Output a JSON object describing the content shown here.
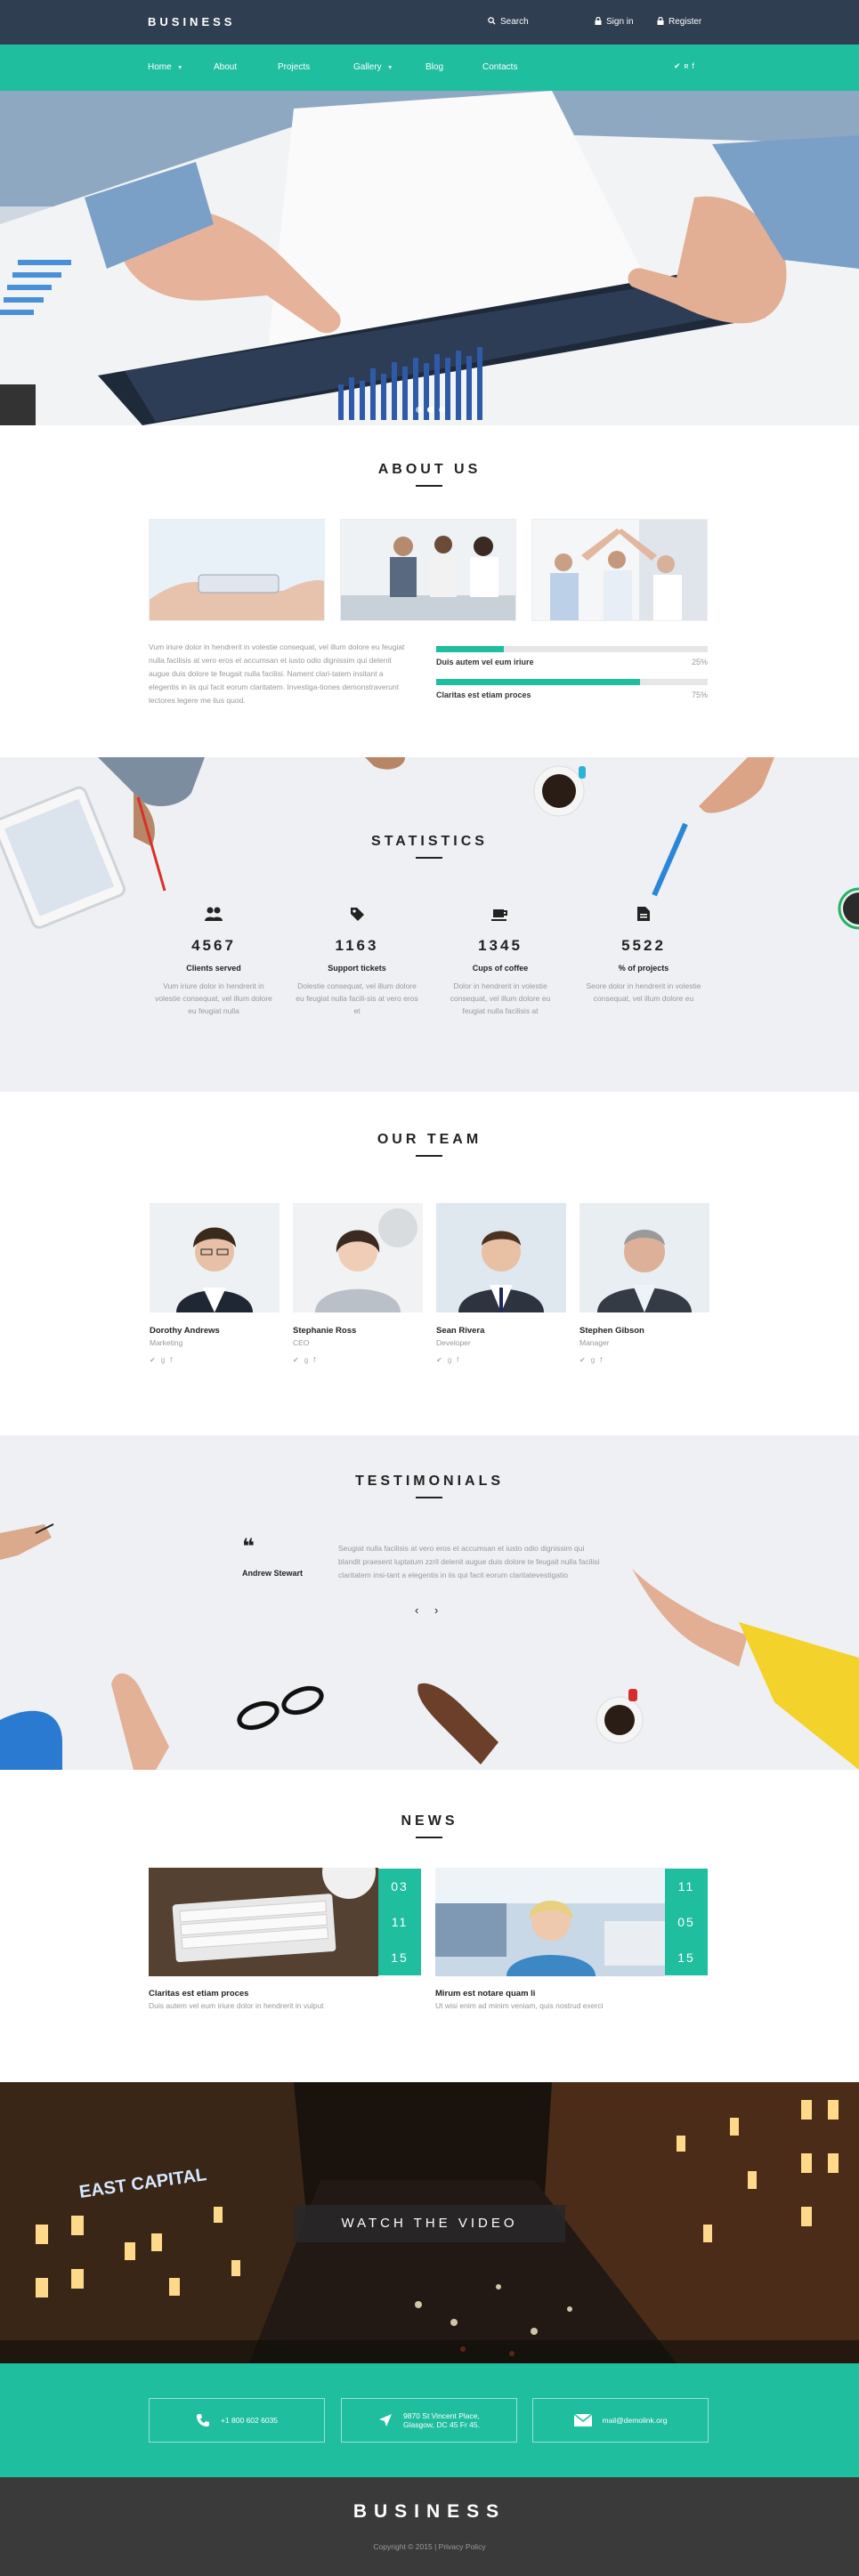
{
  "header": {
    "logo": "BUSINESS",
    "search": "Search",
    "sign_in": "Sign in",
    "register": "Register"
  },
  "nav": {
    "items": [
      "Home",
      "About",
      "Projects",
      "Gallery",
      "Blog",
      "Contacts"
    ],
    "social": [
      "twitter-icon",
      "rss-icon",
      "facebook-icon"
    ]
  },
  "about": {
    "title": "ABOUT US",
    "text": "Vum iriure dolor in hendrerit in volestie consequat, vel illum dolore eu feugiat nulla facilisis at vero eros et accumsan et iusto odio dignissim qui  delenit augue duis dolore te feugait nulla facilisi. Nament clari-tatem insitant a elegentis in iis qui facit eorum claritatem. Investiga-tiones demonstraverunt lectores legere me lius quod.",
    "skills": [
      {
        "label": "Duis autem vel eum iriure",
        "value": 25,
        "pct": "25%"
      },
      {
        "label": "Claritas est etiam proces",
        "value": 75,
        "pct": "75%"
      }
    ]
  },
  "statistics": {
    "title": "STATISTICS",
    "items": [
      {
        "icon": "users-icon",
        "number": "4567",
        "label": "Clients served",
        "text": "Vum iriure dolor in hendrerit in volestie consequat, vel illum dolore eu feugiat nulla"
      },
      {
        "icon": "tag-icon",
        "number": "1163",
        "label": "Support tickets",
        "text": "Dolestie consequat, vel illum dolore eu feugiat nulla facili-sis at vero eros et"
      },
      {
        "icon": "coffee-icon",
        "number": "1345",
        "label": "Cups of coffee",
        "text": "Dolor in hendrerit in volestie consequat, vel illum dolore eu feugiat nulla facilisis at"
      },
      {
        "icon": "document-icon",
        "number": "5522",
        "label": "% of projects",
        "text": "Seore dolor in hendrerit in volestie consequat, vel illum dolore eu"
      }
    ]
  },
  "team": {
    "title": "OUR TEAM",
    "members": [
      {
        "name": "Dorothy Andrews",
        "role": "Marketing"
      },
      {
        "name": "Stephanie Ross",
        "role": "CEO"
      },
      {
        "name": "Sean Rivera",
        "role": "Developer"
      },
      {
        "name": "Stephen Gibson",
        "role": "Manager"
      }
    ]
  },
  "testimonials": {
    "title": "TESTIMONIALS",
    "author": "Andrew Stewart",
    "quote": "Seugiat nulla facilisis at vero eros et accumsan et iusto odio dignissim qui blandit praesent luptatum zzril delenit augue duis dolore te feugait nulla facilisi claritatem insi-tant a elegentis in iis qui facit eorum claritatevestigatio"
  },
  "news": {
    "title": "NEWS",
    "items": [
      {
        "date": [
          "03",
          "11",
          "15"
        ],
        "title": "Claritas est etiam proces",
        "text": "Duis autem vel eum iriure dolor in hendrerit in vulput"
      },
      {
        "date": [
          "11",
          "05",
          "15"
        ],
        "title": "Mirum est notare quam li",
        "text": "Ut wisi enim ad minim veniam, quis nostrud exerci"
      }
    ]
  },
  "video": {
    "button": "WATCH THE VIDEO"
  },
  "contacts": {
    "phone": "+1 800 602 6035",
    "address_line1": "9870 St Vincent Place,",
    "address_line2": "Glasgow, DC 45 Fr 45.",
    "email": "mail@demolink.org"
  },
  "footer": {
    "logo": "BUSINESS",
    "copyright": "Copyright © 2015",
    "separator": "|",
    "privacy": "Privacy Policy"
  },
  "colors": {
    "accent": "#1fbe9f",
    "header": "#2f3e50",
    "footer": "#3a3a3a"
  }
}
